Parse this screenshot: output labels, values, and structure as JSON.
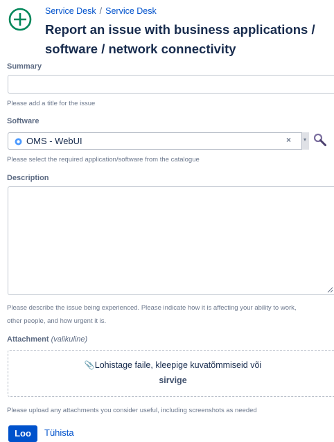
{
  "breadcrumb": {
    "items": [
      "Service Desk",
      "Service Desk"
    ],
    "separator": "/"
  },
  "header": {
    "icon": "plus-circle-icon",
    "title": "Report an issue with business applications / software / network connectivity"
  },
  "summary": {
    "label": "Summary",
    "value": "",
    "help": "Please add a title for the issue"
  },
  "software": {
    "label": "Software",
    "selected": "OMS - WebUI",
    "clear": "×",
    "arrow": "▾",
    "help": "Please select the required application/software from the catalogue"
  },
  "description": {
    "label": "Description",
    "value": "",
    "help_line1": "Please describe the issue being experienced. Please indicate how it is affecting your ability to work,",
    "help_line2": "other people, and how urgent it is."
  },
  "attachment": {
    "label": "Attachment",
    "optional": "(valikuline)",
    "drop_text": "Lohistage faile, kleepige kuvatõmmiseid või",
    "browse": "sirvige",
    "help": "Please upload any attachments you consider useful, including screenshots as needed"
  },
  "actions": {
    "create": "Loo",
    "cancel": "Tühista"
  },
  "colors": {
    "accent": "#0052cc",
    "icon_green": "#00875a",
    "text": "#172b4d",
    "muted": "#6b778c"
  }
}
